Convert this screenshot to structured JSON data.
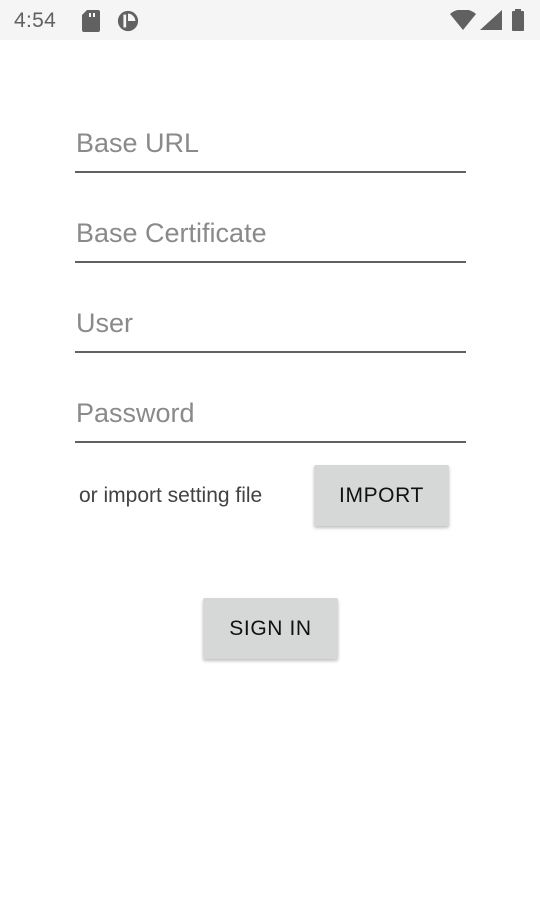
{
  "status_bar": {
    "time": "4:54",
    "icons": [
      "sd-card-icon",
      "pie-icon",
      "wifi-icon",
      "signal-icon",
      "battery-icon"
    ]
  },
  "form": {
    "base_url_placeholder": "Base URL",
    "base_cert_placeholder": "Base Certificate",
    "user_placeholder": "User",
    "password_placeholder": "Password",
    "base_url_value": "",
    "base_cert_value": "",
    "user_value": "",
    "password_value": ""
  },
  "import": {
    "text": "or import setting file",
    "button_label": "IMPORT"
  },
  "actions": {
    "sign_in_label": "SIGN IN"
  },
  "colors": {
    "status_bar_bg": "#f5f5f5",
    "button_bg": "#d6d7d7",
    "underline": "#616161",
    "placeholder": "#8a8a8a"
  }
}
